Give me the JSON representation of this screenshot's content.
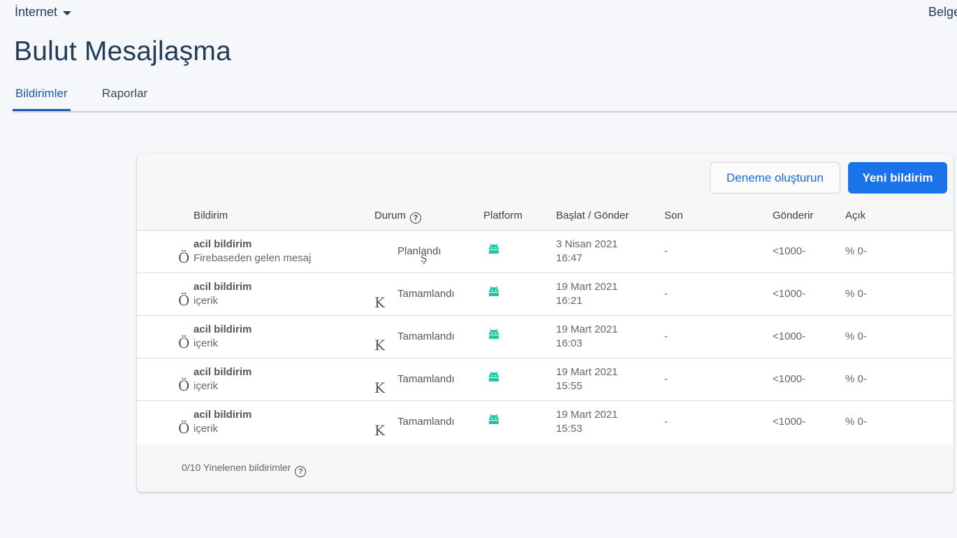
{
  "top": {
    "project": "İnternet",
    "docs_link": "Belge"
  },
  "page": {
    "title": "Bulut Mesajlaşma"
  },
  "tabs": [
    {
      "label": "Bildirimler",
      "active": true
    },
    {
      "label": "Raporlar",
      "active": false
    }
  ],
  "card": {
    "buttons": {
      "test": "Deneme oluşturun",
      "new": "Yeni bildirim"
    },
    "columns": {
      "notification": "Bildirim",
      "status": "Durum",
      "platform": "Platform",
      "start_send": "Başlat / Gönder",
      "end": "Son",
      "sends": "Gönderir",
      "opens": "Açık"
    },
    "help_glyph": "?",
    "rows": [
      {
        "glyph": "Ö",
        "status_glyph": "Ş",
        "name": "acil bildirim",
        "text": "Firebaseden gelen mesaj",
        "status": "Planlandı",
        "platform_icon": "android-icon",
        "date": "3 Nisan 2021",
        "time": "16:47",
        "end": "-",
        "sends": "<1000-",
        "opens": "% 0-"
      },
      {
        "glyph": "Ö",
        "status_glyph": "K",
        "name": "acil bildirim",
        "text": "içerik",
        "status": "Tamamlandı",
        "platform_icon": "android-icon",
        "date": "19 Mart 2021",
        "time": "16:21",
        "end": "-",
        "sends": "<1000-",
        "opens": "% 0-"
      },
      {
        "glyph": "Ö",
        "status_glyph": "K",
        "name": "acil bildirim",
        "text": "içerik",
        "status": "Tamamlandı",
        "platform_icon": "android-icon",
        "date": "19 Mart 2021",
        "time": "16:03",
        "end": "-",
        "sends": "<1000-",
        "opens": "% 0-"
      },
      {
        "glyph": "Ö",
        "status_glyph": "K",
        "name": "acil bildirim",
        "text": "içerik",
        "status": "Tamamlandı",
        "platform_icon": "android-icon",
        "date": "19 Mart 2021",
        "time": "15:55",
        "end": "-",
        "sends": "<1000-",
        "opens": "% 0-"
      },
      {
        "glyph": "Ö",
        "status_glyph": "K",
        "name": "acil bildirim",
        "text": "içerik",
        "status": "Tamamlandı",
        "platform_icon": "android-icon",
        "date": "19 Mart 2021",
        "time": "15:53",
        "end": "-",
        "sends": "<1000-",
        "opens": "% 0-"
      }
    ],
    "footer": "0/10 Yinelenen bildirimler"
  },
  "colors": {
    "accent": "#1a73e8",
    "title": "#1f3c5a",
    "android": "#1ec8a5"
  }
}
